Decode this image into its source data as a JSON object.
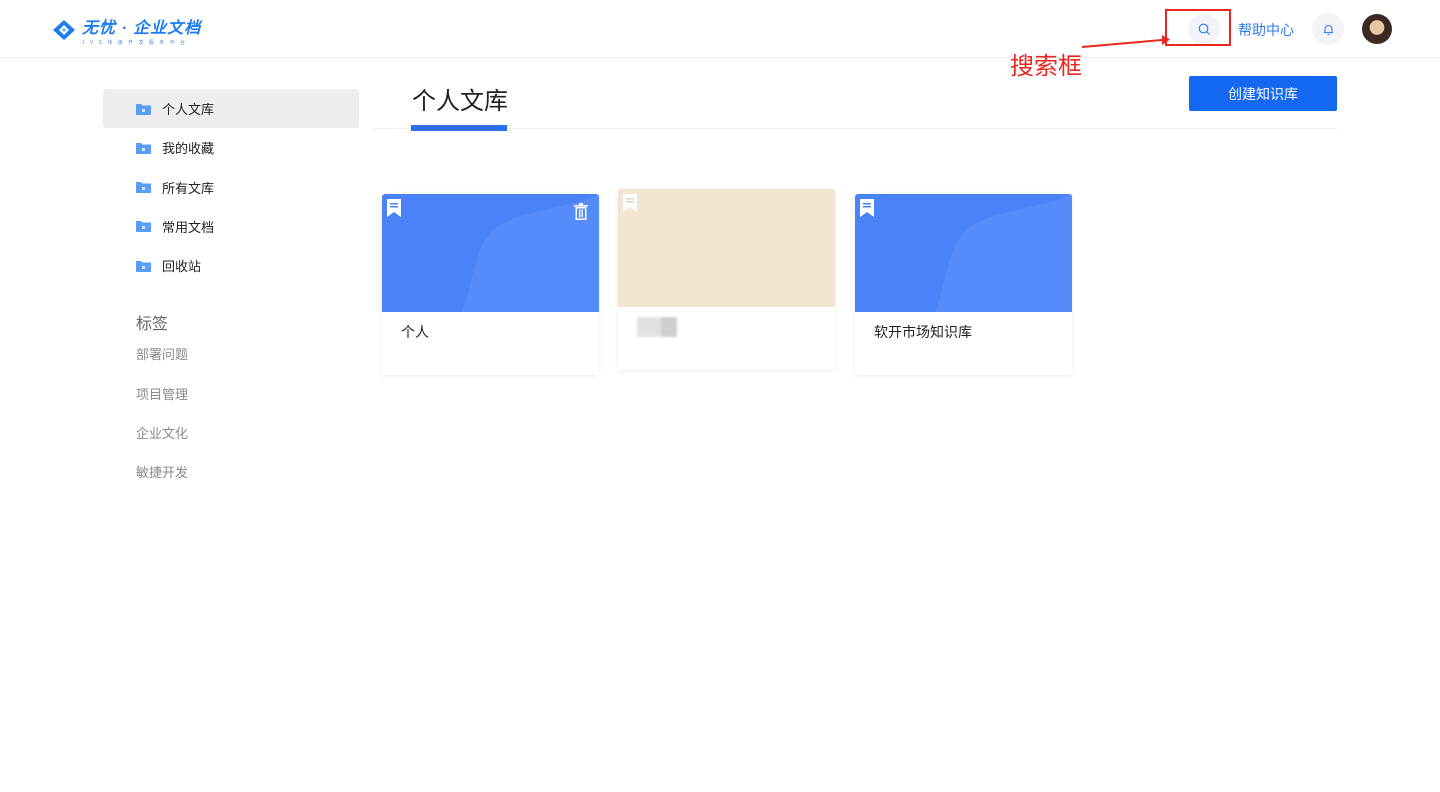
{
  "header": {
    "logo_title": "无忧 · 企业文档",
    "logo_subtitle": "J V S 快 速 开 发 服 务 平 台",
    "help_label": "帮助中心"
  },
  "annotation": {
    "label": "搜索框",
    "color": "#e8281f"
  },
  "sidebar": {
    "items": [
      {
        "label": "个人文库",
        "active": true
      },
      {
        "label": "我的收藏",
        "active": false
      },
      {
        "label": "所有文库",
        "active": false
      },
      {
        "label": "常用文档",
        "active": false
      },
      {
        "label": "回收站",
        "active": false
      }
    ],
    "tags_title": "标签",
    "tags": [
      "部署问题",
      "项目管理",
      "企业文化",
      "敏捷开发"
    ]
  },
  "main": {
    "title": "个人文库",
    "create_button": "创建知识库",
    "cards": [
      {
        "name": "个人",
        "cover_color": "#4a82f7",
        "has_delete": true
      },
      {
        "name": "",
        "cover_color": "#f2e5d1",
        "blurred": true
      },
      {
        "name": "软开市场知识库",
        "cover_color": "#4a82f7",
        "has_delete": false
      }
    ]
  },
  "colors": {
    "accent": "#1468f2",
    "link": "#2f7ef5",
    "card_blue": "#4a82f7",
    "card_beige": "#f2e5d1"
  },
  "icons": [
    "logo-icon",
    "search-icon",
    "bell-icon",
    "folder-icon",
    "bookmark-icon",
    "trash-icon"
  ]
}
